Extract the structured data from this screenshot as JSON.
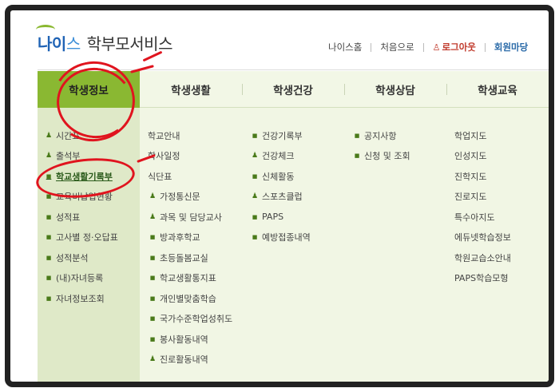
{
  "header": {
    "logo_part1": "나이",
    "logo_part2": "스",
    "logo_service": "학부모서비스",
    "links": {
      "home": "나이스홈",
      "first": "처음으로",
      "logout": "로그아웃",
      "member": "회원마당"
    }
  },
  "nav": {
    "items": [
      "학생정보",
      "학생생활",
      "학생건강",
      "학생상담",
      "학생교육"
    ],
    "active_index": 0
  },
  "submenu": {
    "col1": [
      {
        "label": "시간표",
        "icon": "person-icon"
      },
      {
        "label": "출석부",
        "icon": "person-icon"
      },
      {
        "label": "학교생활기록부",
        "icon": "lock-icon",
        "highlight": true
      },
      {
        "label": "교육비납입현황",
        "icon": "lock-icon"
      },
      {
        "label": "성적표",
        "icon": "lock-icon"
      },
      {
        "label": "고사별 정·오답표",
        "icon": "lock-icon"
      },
      {
        "label": "성적분석",
        "icon": "lock-icon"
      },
      {
        "label": "(내)자녀등록",
        "icon": "lock-icon"
      },
      {
        "label": "자녀정보조회",
        "icon": "lock-icon"
      }
    ],
    "col2": [
      {
        "label": "학교안내",
        "icon": ""
      },
      {
        "label": "학사일정",
        "icon": ""
      },
      {
        "label": "식단표",
        "icon": ""
      },
      {
        "label": "가정통신문",
        "icon": "person-icon"
      },
      {
        "label": "과목 및 담당교사",
        "icon": "person-icon"
      },
      {
        "label": "방과후학교",
        "icon": "lock-icon"
      },
      {
        "label": "초등돌봄교실",
        "icon": "lock-icon"
      },
      {
        "label": "학교생활통지표",
        "icon": "lock-icon"
      },
      {
        "label": "개인별맞춤학습",
        "icon": "lock-icon"
      },
      {
        "label": "국가수준학업성취도",
        "icon": "lock-icon"
      },
      {
        "label": "봉사활동내역",
        "icon": "lock-icon"
      },
      {
        "label": "진로활동내역",
        "icon": "person-icon"
      }
    ],
    "col3": [
      {
        "label": "건강기록부",
        "icon": "lock-icon"
      },
      {
        "label": "건강체크",
        "icon": "person-icon"
      },
      {
        "label": "신체활동",
        "icon": "lock-icon"
      },
      {
        "label": "스포츠클럽",
        "icon": "person-icon"
      },
      {
        "label": "PAPS",
        "icon": "lock-icon"
      },
      {
        "label": "예방접종내역",
        "icon": "lock-icon"
      }
    ],
    "col4": [
      {
        "label": "공지사항",
        "icon": "lock-icon"
      },
      {
        "label": "신청 및 조회",
        "icon": "lock-icon"
      }
    ],
    "col5": [
      {
        "label": "학업지도",
        "icon": ""
      },
      {
        "label": "인성지도",
        "icon": ""
      },
      {
        "label": "진학지도",
        "icon": ""
      },
      {
        "label": "진로지도",
        "icon": ""
      },
      {
        "label": "특수아지도",
        "icon": ""
      },
      {
        "label": "에듀넷학습정보",
        "icon": ""
      },
      {
        "label": "학원교습소안내",
        "icon": ""
      },
      {
        "label": "PAPS학습모형",
        "icon": ""
      }
    ]
  },
  "colors": {
    "nav_active": "#8ab832",
    "nav_bg": "#f2f7e6",
    "submenu_bg": "#f1f6e4",
    "col1_bg": "#dfe9c8",
    "logout": "#c0392b",
    "member": "#2a6aa8",
    "annotation": "#e0141e"
  }
}
